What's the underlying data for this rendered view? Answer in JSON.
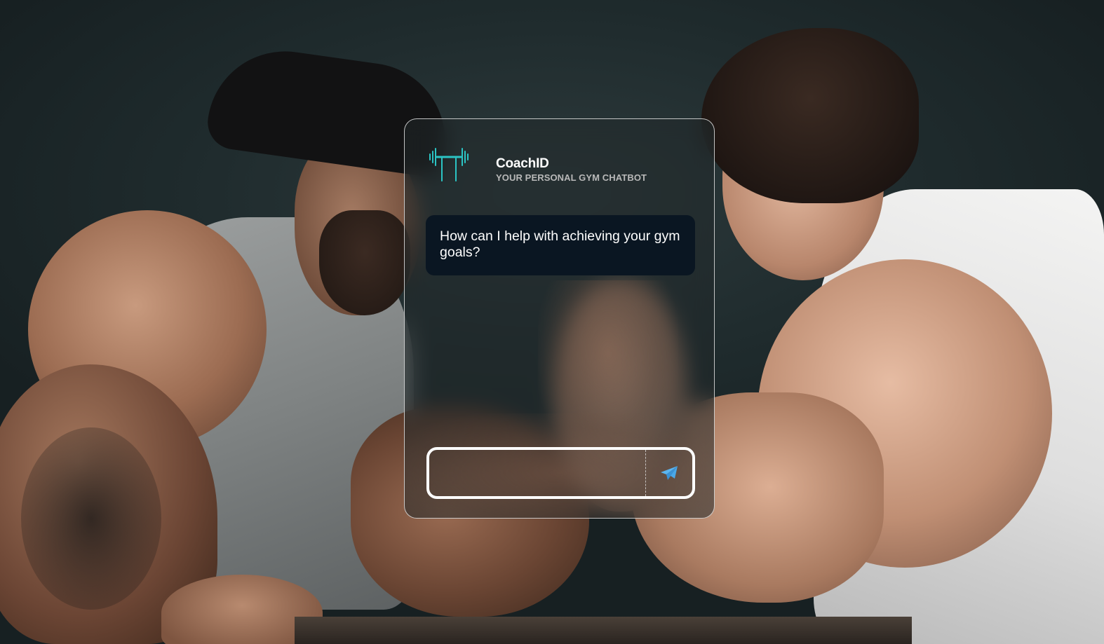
{
  "background": {
    "description_icon": "arm-wrestling-photo"
  },
  "app": {
    "name": "CoachID",
    "subtitle": "YOUR PERSONAL GYM CHATBOT",
    "logo_icon": "barbell-icon",
    "accent_color": "#2bc4c4"
  },
  "chat": {
    "messages": [
      {
        "role": "bot",
        "text": "How can I help with achieving your gym goals?"
      }
    ]
  },
  "composer": {
    "input_value": "",
    "placeholder": "",
    "send_icon": "paper-plane-icon",
    "send_icon_color": "#4aa8e8"
  }
}
